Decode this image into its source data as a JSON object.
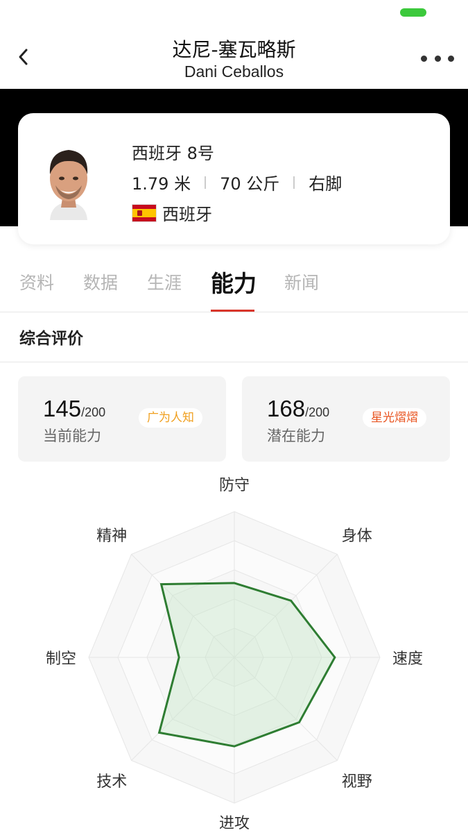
{
  "header": {
    "title_cn": "达尼-塞瓦略斯",
    "title_en": "Dani Ceballos"
  },
  "player": {
    "team_number": "西班牙 8号",
    "height": "1.79 米",
    "weight": "70 公斤",
    "foot": "右脚",
    "nationality": "西班牙"
  },
  "tabs": [
    {
      "label": "资料",
      "active": false
    },
    {
      "label": "数据",
      "active": false
    },
    {
      "label": "生涯",
      "active": false
    },
    {
      "label": "能力",
      "active": true
    },
    {
      "label": "新闻",
      "active": false
    }
  ],
  "section": {
    "title": "综合评价"
  },
  "stats": {
    "current": {
      "value": "145",
      "max": "/200",
      "label": "当前能力",
      "badge": "广为人知",
      "badge_color": "#f0a020"
    },
    "potential": {
      "value": "168",
      "max": "/200",
      "label": "潜在能力",
      "badge": "星光熠熠",
      "badge_color": "#e8531f"
    }
  },
  "radar": {
    "axes": [
      "防守",
      "身体",
      "速度",
      "视野",
      "进攻",
      "技术",
      "制空",
      "精神"
    ],
    "values": [
      0.51,
      0.55,
      0.69,
      0.63,
      0.61,
      0.73,
      0.38,
      0.71
    ],
    "line_color": "#2e7d32",
    "fill_color": "#c8e6c9"
  }
}
